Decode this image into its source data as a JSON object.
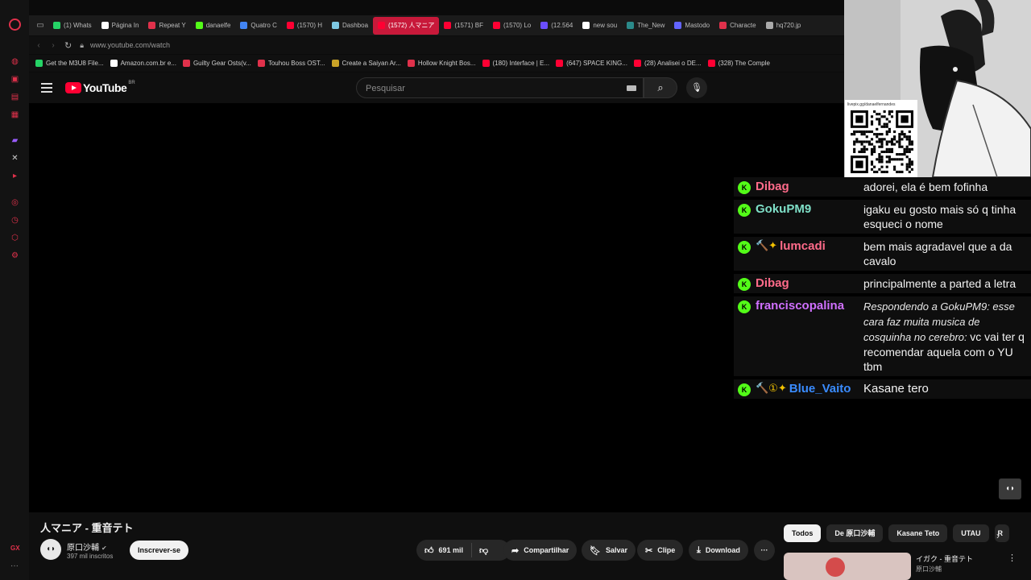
{
  "browser": {
    "tabs": [
      {
        "label": "(1) Whats",
        "color": "#25d366",
        "active": false
      },
      {
        "label": "Página In",
        "color": "#ffffff",
        "active": false
      },
      {
        "label": "Repeat Y",
        "color": "#e0314b",
        "active": false
      },
      {
        "label": "danaelfe",
        "color": "#53fc18",
        "active": false
      },
      {
        "label": "Quatro C",
        "color": "#4285f4",
        "active": false
      },
      {
        "label": "(1570) H",
        "color": "#ff0033",
        "active": false
      },
      {
        "label": "Dashboa",
        "color": "#7ec8e3",
        "active": false
      },
      {
        "label": "(1572) 人マニア",
        "color": "#ff0033",
        "active": true
      },
      {
        "label": "(1571) BF",
        "color": "#ff0033",
        "active": false
      },
      {
        "label": "(1570) Lo",
        "color": "#ff0033",
        "active": false
      },
      {
        "label": "(12.564",
        "color": "#6b4eff",
        "active": false
      },
      {
        "label": "new sou",
        "color": "#ffffff",
        "active": false
      },
      {
        "label": "The_New",
        "color": "#2b8a8a",
        "active": false
      },
      {
        "label": "Mastodo",
        "color": "#6364ff",
        "active": false
      },
      {
        "label": "Characte",
        "color": "#e0314b",
        "active": false
      },
      {
        "label": "hq720.jp",
        "color": "#aaaaaa",
        "active": false
      }
    ],
    "url": "www.youtube.com/watch",
    "bookmarks": [
      {
        "label": "Get the M3U8 File...",
        "color": "#25d366"
      },
      {
        "label": "Amazon.com.br e...",
        "color": "#ffffff"
      },
      {
        "label": "Guilty Gear Osts(v...",
        "color": "#e0314b"
      },
      {
        "label": "Touhou Boss OST...",
        "color": "#e0314b"
      },
      {
        "label": "Create a Saiyan Ar...",
        "color": "#c9a227"
      },
      {
        "label": "Hollow Knight Bos...",
        "color": "#e0314b"
      },
      {
        "label": "(180) Interface | E...",
        "color": "#ff0033"
      },
      {
        "label": "(647) SPACE KING...",
        "color": "#ff0033"
      },
      {
        "label": "(28) Analisei o DE...",
        "color": "#ff0033"
      },
      {
        "label": "(328) The Comple",
        "color": "#ff0033"
      }
    ],
    "sidebar_bottom": "GX"
  },
  "youtube": {
    "logo_text": "YouTube",
    "country": "BR",
    "search_placeholder": "Pesquisar",
    "video_title": "人マニア - 重音テト",
    "channel_name": "原口沙輔",
    "subscribers": "397 mil inscritos",
    "subscribe_label": "Inscrever-se",
    "likes": "691 mil",
    "share_label": "Compartilhar",
    "save_label": "Salvar",
    "clip_label": "Clipe",
    "download_label": "Download",
    "chips": [
      {
        "label": "Todos",
        "active": true
      },
      {
        "label": "De 原口沙輔",
        "active": false
      },
      {
        "label": "Kasane Teto",
        "active": false
      },
      {
        "label": "UTAU",
        "active": false
      },
      {
        "label": "R",
        "active": false
      }
    ],
    "reco_title": "イガク - 重音テト",
    "reco_channel": "原口沙輔"
  },
  "stream_overlay": {
    "qr_label": "livepix.gg/danaelfernandes",
    "chat": [
      {
        "user": "Dibag",
        "color": "#ff6b8a",
        "badges": "",
        "text": "adorei, ela é bem fofinha",
        "reply": ""
      },
      {
        "user": "GokuPM9",
        "color": "#7fe0c8",
        "badges": "",
        "text": "igaku eu gosto mais só q tinha esqueci o nome",
        "reply": ""
      },
      {
        "user": "lumcadi",
        "color": "#ff6b8a",
        "badges": "🔨✦",
        "text": "bem mais agradavel que a da cavalo",
        "reply": ""
      },
      {
        "user": "Dibag",
        "color": "#ff6b8a",
        "badges": "",
        "text": "principalmente a parted a letra",
        "reply": ""
      },
      {
        "user": "franciscopalina",
        "color": "#d070ff",
        "badges": "",
        "text": "vc vai ter q recomendar aquela com o YU tbm",
        "reply": "Respondendo a GokuPM9: esse cara faz muita musica de cosquinha no cerebro: "
      },
      {
        "user": "Blue_Vaito",
        "color": "#3a8cff",
        "badges": "🔨①✦",
        "text": "Kasane tero",
        "reply": ""
      }
    ]
  }
}
